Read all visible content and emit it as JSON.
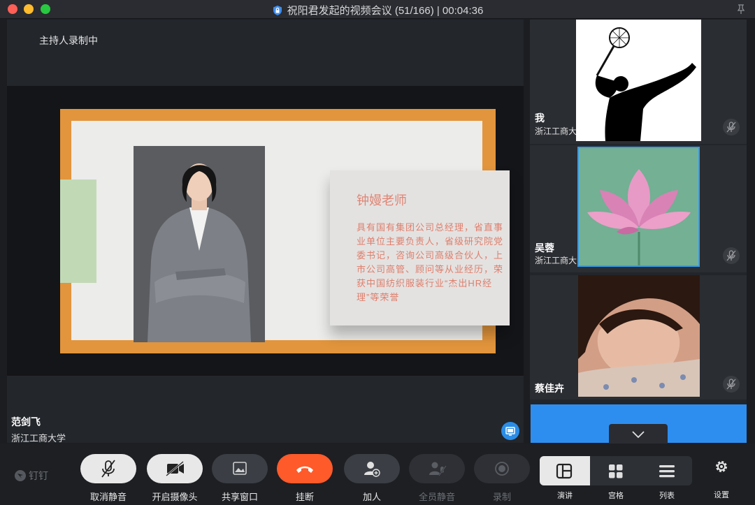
{
  "window": {
    "title": "祝阳君发起的视频会议 (51/166) | 00:04:36"
  },
  "main": {
    "recording_status": "主持人录制中",
    "slide": {
      "title": "钟嫚老师",
      "body": "具有国有集团公司总经理，省直事业单位主要负责人，省级研究院党委书记，咨询公司高级合伙人，上市公司高管、顾问等从业经历，荣获中国纺织服装行业“杰出HR经理”等荣誉"
    },
    "speaker": {
      "name": "范剑飞",
      "org": "浙江工商大学"
    }
  },
  "participants": [
    {
      "name": "我",
      "org": "浙江工商大",
      "muted": true,
      "avatar": "badminton-silhouette"
    },
    {
      "name": "吴蓉",
      "org": "浙江工商大",
      "muted": true,
      "avatar": "lotus-flower"
    },
    {
      "name": "蔡佳卉",
      "org": "",
      "muted": true,
      "avatar": "portrait-photo"
    }
  ],
  "toolbar": {
    "brand": "钉钉",
    "mute_label": "取消静音",
    "camera_label": "开启摄像头",
    "share_label": "共享窗口",
    "hangup_label": "挂断",
    "add_label": "加人",
    "mute_all_label": "全员静音",
    "record_label": "录制",
    "view_speaker_label": "演讲",
    "view_grid_label": "宫格",
    "view_list_label": "列表",
    "settings_label": "设置"
  },
  "colors": {
    "accent": "#2e8ef0",
    "hangup": "#ff5a2a",
    "slide_frame": "#e2953c"
  }
}
